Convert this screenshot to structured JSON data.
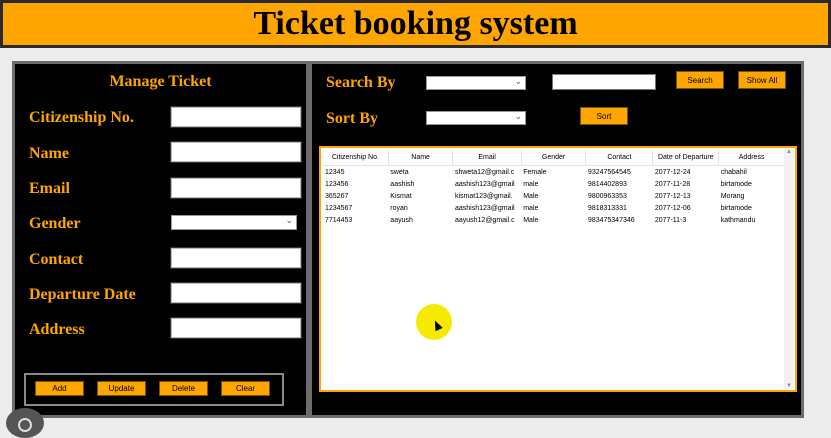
{
  "app": {
    "title": "Ticket booking system"
  },
  "manage": {
    "heading": "Manage Ticket",
    "labels": {
      "citizenship": "Citizenship No.",
      "name": "Name",
      "email": "Email",
      "gender": "Gender",
      "contact": "Contact",
      "departure": "Departure Date",
      "address": "Address"
    },
    "values": {
      "citizenship": "",
      "name": "",
      "email": "",
      "gender": "",
      "contact": "",
      "departure": "",
      "address": ""
    },
    "buttons": {
      "add": "Add",
      "update": "Update",
      "delete": "Delete",
      "clear": "Clear"
    }
  },
  "search": {
    "search_by_label": "Search By",
    "sort_by_label": "Sort By",
    "search_by_value": "",
    "sort_by_value": "",
    "search_text": "",
    "search_button": "Search",
    "show_all_button": "Show All",
    "sort_button": "Sort"
  },
  "table": {
    "columns": [
      "Citizenship No.",
      "Name",
      "Email",
      "Gender",
      "Contact",
      "Date of Departure",
      "Address"
    ],
    "rows": [
      [
        "12345",
        "sweta",
        "shweta12@gmail.c",
        "Female",
        "93247564545",
        "2077-12-24",
        "chabahil"
      ],
      [
        "123456",
        "aashish",
        "aashish123@gmail",
        "male",
        "9814402893",
        "2077-11-28",
        "birtamode"
      ],
      [
        "365267",
        "Kismat",
        "kismat123@gmail.",
        "Male",
        "9800963353",
        "2077-12-13",
        "Morang"
      ],
      [
        "1234567",
        "royan",
        "aashish123@gmail",
        "male",
        "9818313331",
        "2077-12-06",
        "birtamode"
      ],
      [
        "7714453",
        "aayush",
        "aayush12@gmail.c",
        "Male",
        "983475347346",
        "2077-11-3",
        "kathmandu"
      ]
    ]
  },
  "colors": {
    "accent": "#ffa500",
    "panel": "#000000"
  }
}
